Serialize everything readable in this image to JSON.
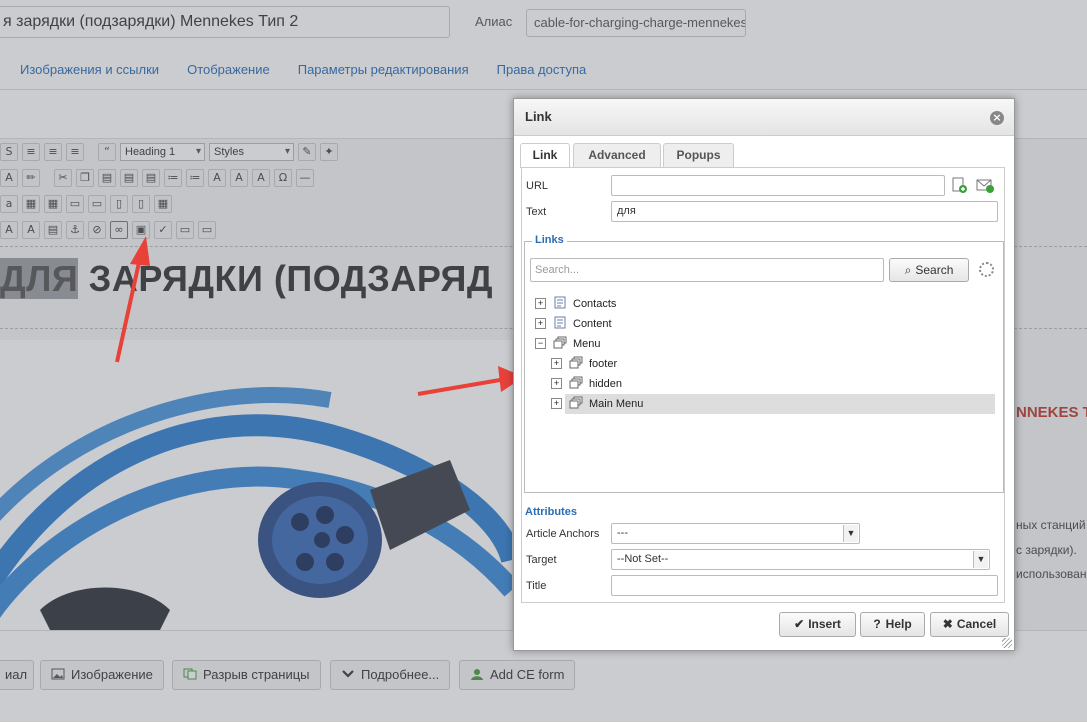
{
  "page": {
    "title_value": "я зарядки (подзарядки) Mennekes Тип 2",
    "alias_label": "Алиас",
    "alias_value": "cable-for-charging-charge-mennekes",
    "tabs": [
      "Изображения и ссылки",
      "Отображение",
      "Параметры редактирования",
      "Права доступа"
    ],
    "toolbar": {
      "heading_select": "Heading 1",
      "styles_select": "Styles"
    },
    "content_heading_highlight": "ДЛЯ",
    "content_heading_rest": "ЗАРЯДКИ (ПОДЗАРЯД",
    "right_red_text": "NNEKES ТИ",
    "right_lines": [
      "ных станций",
      "с зарядки).",
      "использован"
    ],
    "bottom_buttons": [
      "иал",
      "Изображение",
      "Разрыв страницы",
      "Подробнее...",
      "Add CE form"
    ]
  },
  "dialog": {
    "title": "Link",
    "tabs": [
      "Link",
      "Advanced",
      "Popups"
    ],
    "url_label": "URL",
    "url_value": "",
    "text_label": "Text",
    "text_value": "для",
    "links_legend": "Links",
    "search_placeholder": "Search...",
    "search_button": "Search",
    "tree": [
      {
        "label": "Contacts",
        "expander": "+"
      },
      {
        "label": "Content",
        "expander": "+"
      },
      {
        "label": "Menu",
        "expander": "−"
      },
      {
        "label": "footer",
        "expander": "+"
      },
      {
        "label": "hidden",
        "expander": "+"
      },
      {
        "label": "Main Menu",
        "expander": "+"
      }
    ],
    "attributes_title": "Attributes",
    "anchors_label": "Article Anchors",
    "anchors_value": "---",
    "target_label": "Target",
    "target_value": "--Not Set--",
    "title_label": "Title",
    "title_value": "",
    "buttons": {
      "insert": "Insert",
      "help": "Help",
      "cancel": "Cancel"
    }
  },
  "colors": {
    "accent": "#2a6db5",
    "red_text": "#c0392b",
    "arrow": "#e8413a"
  }
}
